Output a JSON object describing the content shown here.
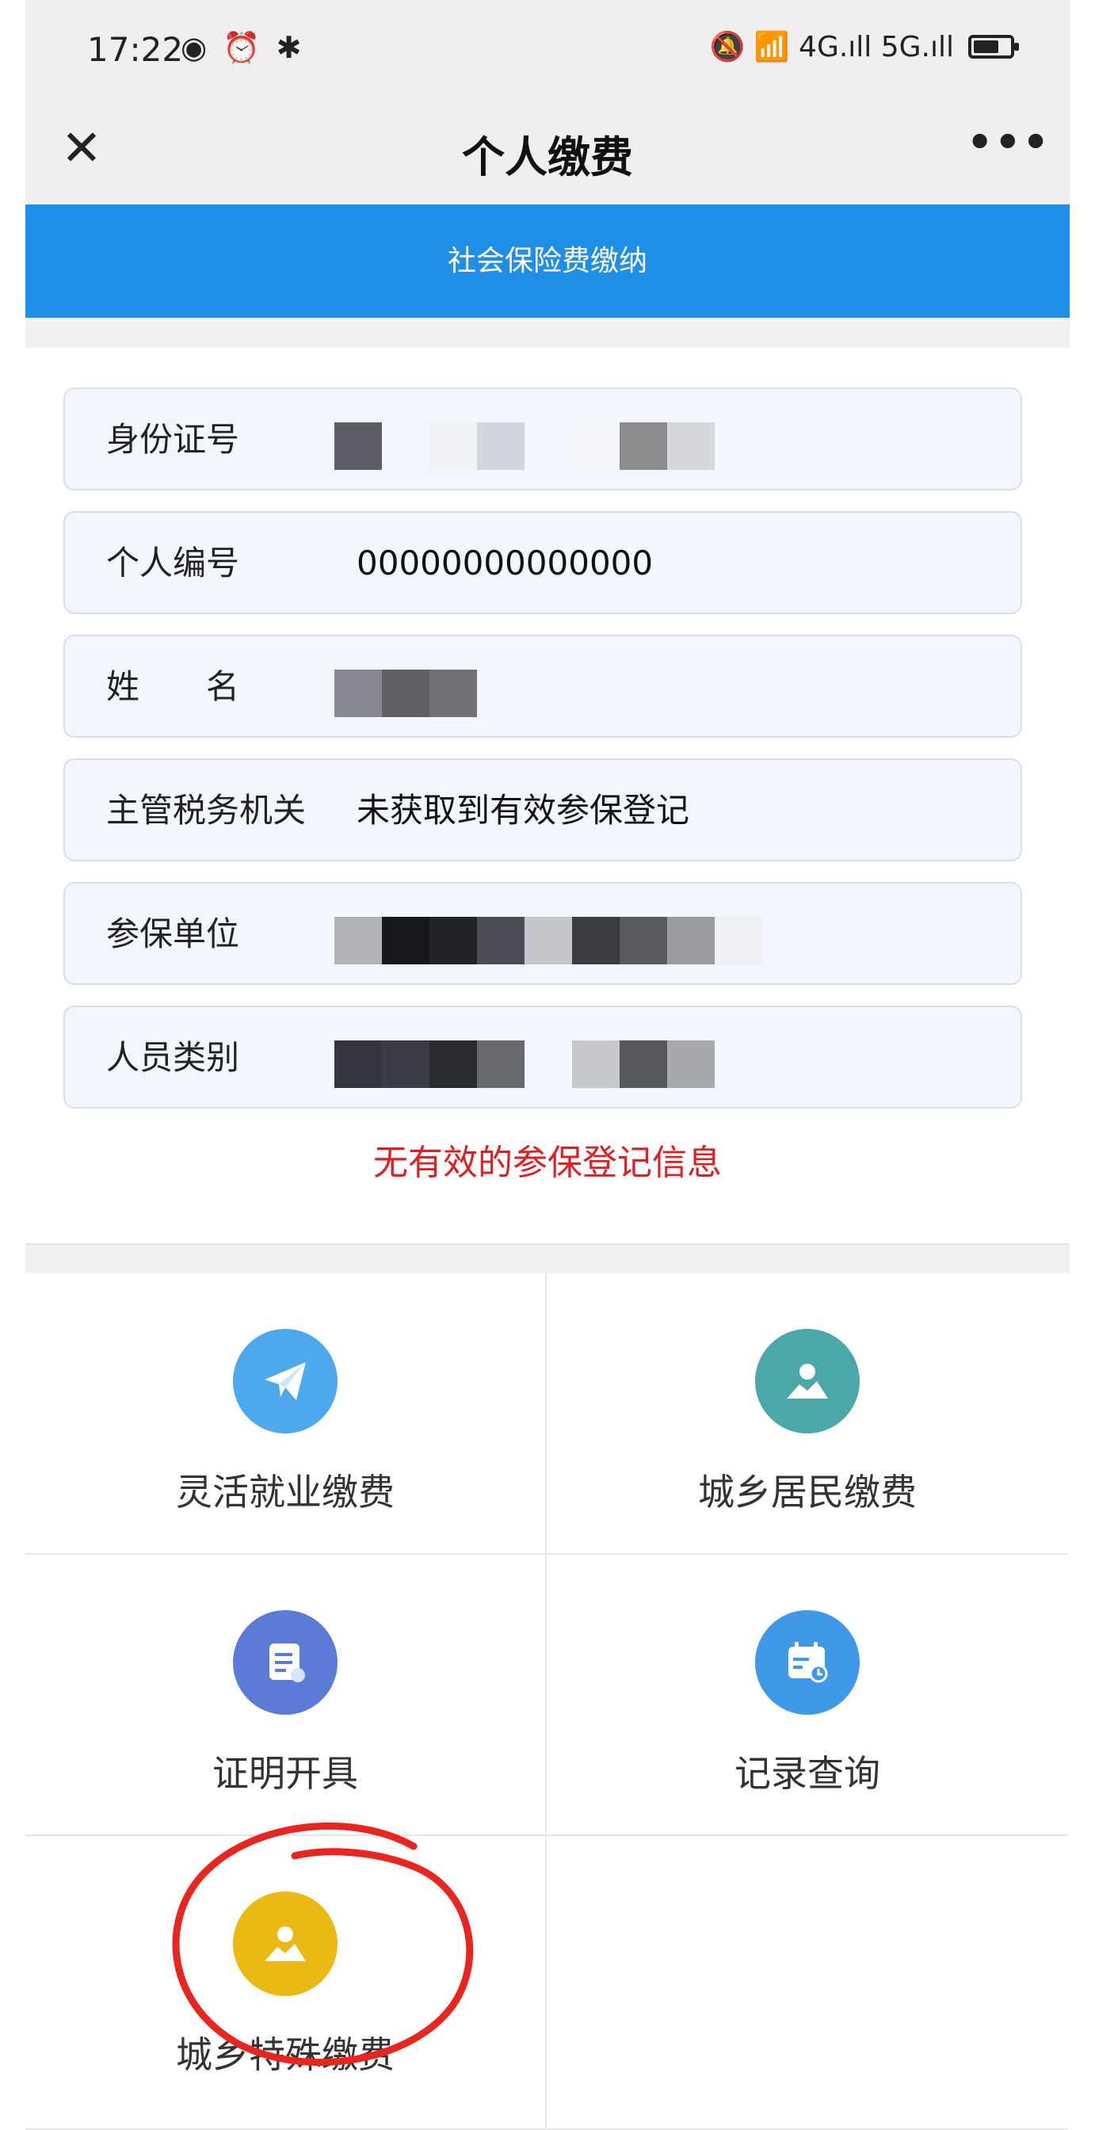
{
  "status_bar": {
    "time": "17:22",
    "left_icons": "◉ ⏰ ✱",
    "right_icons": "🔕 📶 4G.ıll 5G.ıll"
  },
  "nav": {
    "title": "个人缴费",
    "close": "✕",
    "more": "•••"
  },
  "banner": {
    "text": "社会保险费缴纳"
  },
  "info_rows": [
    {
      "label": "身份证号",
      "value": ""
    },
    {
      "label": "个人编号",
      "value": "00000000000000"
    },
    {
      "label": "姓　　名",
      "value": ""
    },
    {
      "label": "主管税务机关",
      "value": "未获取到有效参保登记"
    },
    {
      "label": "参保单位",
      "value": ""
    },
    {
      "label": "人员类别",
      "value": ""
    }
  ],
  "error_text": "无有效的参保登记信息",
  "menu": [
    {
      "label": "灵活就业缴费",
      "icon": "paper-plane-icon",
      "color": "#4ea8ee"
    },
    {
      "label": "城乡居民缴费",
      "icon": "person-landscape-icon",
      "color": "#4aa8a8"
    },
    {
      "label": "证明开具",
      "icon": "document-icon",
      "color": "#5b7bd6"
    },
    {
      "label": "记录查询",
      "icon": "calendar-icon",
      "color": "#3f98e8"
    },
    {
      "label": "城乡特殊缴费",
      "icon": "person-landscape-icon",
      "color": "#ecb814"
    }
  ]
}
